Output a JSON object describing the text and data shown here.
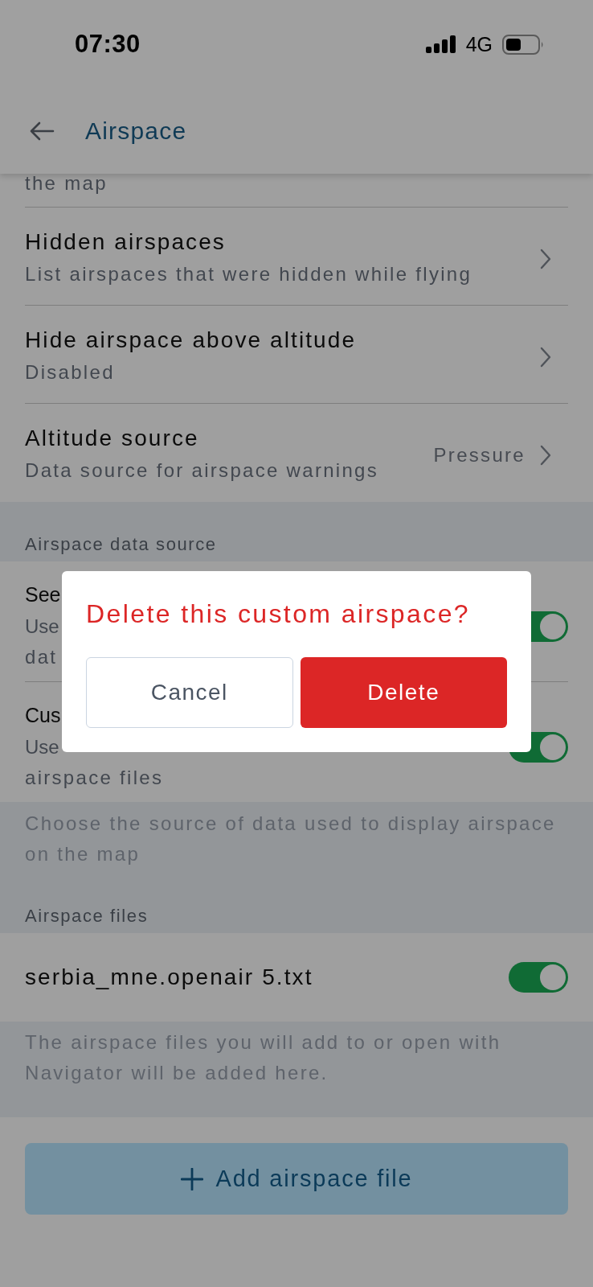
{
  "status_bar": {
    "time": "07:30",
    "network": "4G"
  },
  "app_bar": {
    "title": "Airspace"
  },
  "scrolled_text": "the map",
  "settings": [
    {
      "title": "Hidden airspaces",
      "subtitle": "List airspaces that were hidden while flying"
    },
    {
      "title": "Hide airspace above altitude",
      "subtitle": "Disabled"
    },
    {
      "title": "Altitude source",
      "subtitle": "Data source for airspace warnings",
      "value": "Pressure"
    }
  ],
  "data_source": {
    "header": "Airspace data source",
    "items": [
      {
        "title": "See",
        "subtitle_lines": [
          "Use",
          "dat"
        ],
        "on": true
      },
      {
        "title": "Cus",
        "subtitle_lines": [
          "Use",
          "airspace files"
        ],
        "on": true
      }
    ],
    "footer": "Choose the source of data used to display airspace on the map"
  },
  "airspace_files": {
    "header": "Airspace files",
    "items": [
      {
        "name": "serbia_mne.openair 5.txt",
        "on": true
      }
    ],
    "footer": "The airspace files you will add to or open with Navigator will be added here."
  },
  "add_button": {
    "label": "Add airspace file"
  },
  "dialog": {
    "title": "Delete this custom airspace?",
    "buttons": [
      {
        "label": "Cancel",
        "kind": "secondary"
      },
      {
        "label": "Delete",
        "kind": "danger"
      }
    ]
  }
}
